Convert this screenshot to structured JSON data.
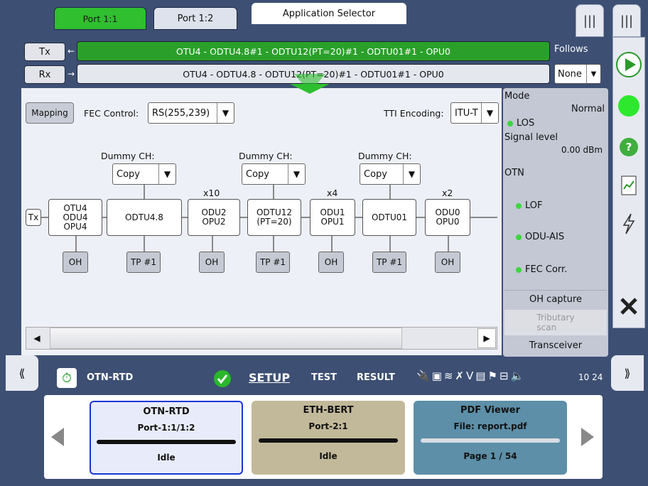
{
  "top": {
    "ports": [
      "Port 1:1",
      "Port 1:2"
    ],
    "app_selector": "Application Selector"
  },
  "signal": {
    "tx_label": "Tx",
    "rx_label": "Rx",
    "tx_path": "OTU4 - ODTU4.8#1 - ODTU12(PT=20)#1 - ODTU01#1 - OPU0",
    "rx_path": "OTU4 - ODTU4.8 - ODTU12(PT=20)#1 - ODTU01#1 - OPU0",
    "follows_label": "Follows",
    "follows_value": "None"
  },
  "config": {
    "mapping_label": "Mapping",
    "fec_label": "FEC Control:",
    "fec_value": "RS(255,239)",
    "tti_label": "TTI Encoding:",
    "tti_value": "ITU-T"
  },
  "diagram": {
    "tx_label": "Tx",
    "dummy_label": "Dummy CH:",
    "dummy_value": "Copy",
    "nodes": {
      "otu4": [
        "OTU4",
        "ODU4",
        "OPU4"
      ],
      "odtu48": [
        "ODTU4.8"
      ],
      "odu2": [
        "ODU2",
        "OPU2"
      ],
      "odtu12": [
        "ODTU12",
        "(PT=20)"
      ],
      "odu1": [
        "ODU1",
        "OPU1"
      ],
      "odtu01": [
        "ODTU01"
      ],
      "odu0": [
        "ODU0",
        "OPU0"
      ]
    },
    "multipliers": [
      "x10",
      "x4",
      "x2"
    ],
    "oh_label": "OH",
    "tp_label": "TP #1"
  },
  "status": {
    "mode_label": "Mode",
    "mode_value": "Normal",
    "los": "LOS",
    "signal_level_label": "Signal level",
    "signal_level_value": "0.00 dBm",
    "otn_label": "OTN",
    "lof": "LOF",
    "odu_ais": "ODU-AIS",
    "fec_corr": "FEC Corr.",
    "oh_capture": "OH capture",
    "tributary_scan": "Tributary\nscan",
    "transceiver": "Transceiver",
    "led_color": "#3ed63e"
  },
  "taskbar": {
    "app_name": "OTN-RTD",
    "setup": "SETUP",
    "test": "TEST",
    "result": "RESULT",
    "time": "10 24"
  },
  "apps": [
    {
      "title": "OTN-RTD",
      "port": "Port-1:1/1:2",
      "status": "Idle"
    },
    {
      "title": "ETH-BERT",
      "port": "Port-2:1",
      "status": "Idle"
    },
    {
      "title": "PDF Viewer",
      "port": "File: report.pdf",
      "status": "Page 1 / 54"
    }
  ]
}
